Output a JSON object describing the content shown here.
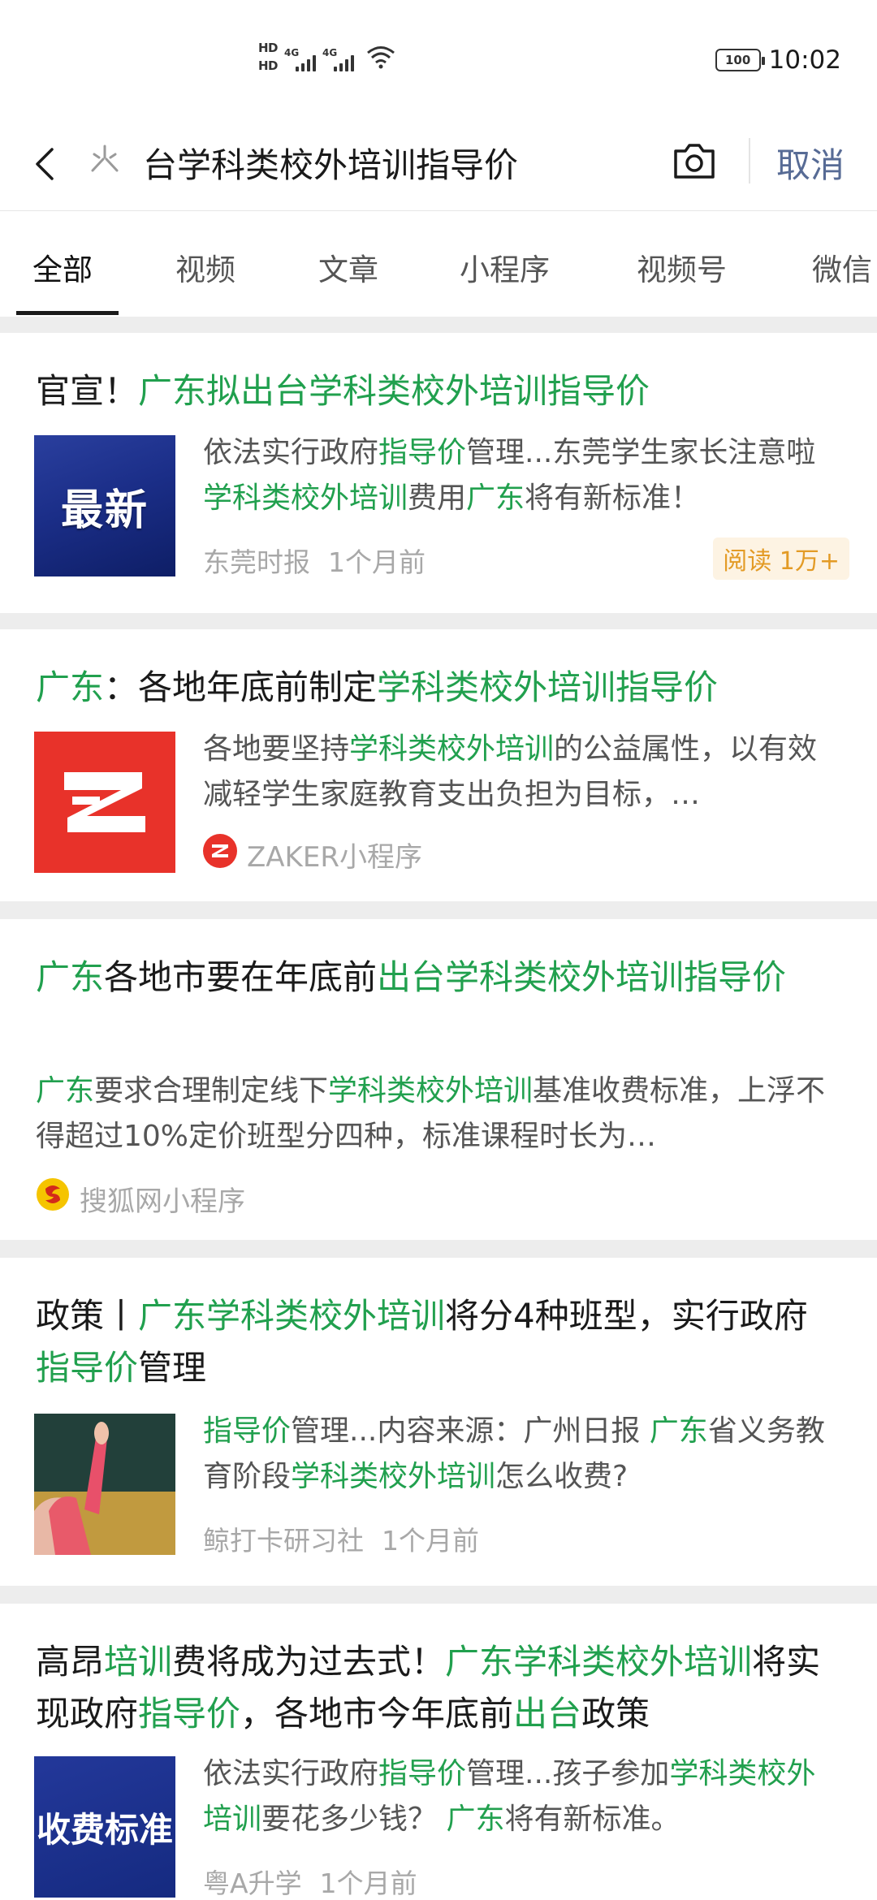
{
  "status_bar": {
    "hd1": "HD",
    "hd2": "HD",
    "net1": "4G",
    "net2": "4G",
    "battery": "100",
    "time": "10:02"
  },
  "search": {
    "query": "台学科类校外培训指导价",
    "cancel_label": "取消"
  },
  "tabs": [
    {
      "label": "全部",
      "active": true
    },
    {
      "label": "视频",
      "active": false
    },
    {
      "label": "文章",
      "active": false
    },
    {
      "label": "小程序",
      "active": false
    },
    {
      "label": "视频号",
      "active": false
    },
    {
      "label": "微信",
      "active": false
    }
  ],
  "colors": {
    "highlight": "#21a04e",
    "cancel": "#576b95",
    "badge": "#e39b26",
    "separator": "#ededed"
  },
  "results": [
    {
      "title_parts": [
        [
          "官宣！",
          false
        ],
        [
          "广东拟出台学科类校外培训指导价",
          true
        ]
      ],
      "thumb_text": "最新",
      "snippet_parts": [
        [
          "依法实行政府",
          false
        ],
        [
          "指导价",
          true
        ],
        [
          "管理...东莞学生家长注意啦",
          false
        ],
        [
          "学科类校外培训",
          true
        ],
        [
          "费用",
          false
        ],
        [
          "广东",
          true
        ],
        [
          "将有新标准！",
          false
        ]
      ],
      "source": "东莞时报",
      "time": "1个月前",
      "badge": "阅读 1万+"
    },
    {
      "title_parts": [
        [
          "广东",
          true
        ],
        [
          "：各地年底前制定",
          false
        ],
        [
          "学科类校外培训指导价",
          true
        ]
      ],
      "thumb_text": "Z",
      "snippet_parts": [
        [
          "各地要坚持",
          false
        ],
        [
          "学科类校外培训",
          true
        ],
        [
          "的公益属性，以有效减轻学生家庭教育支出负担为目标，…",
          false
        ]
      ],
      "source_icon": "zaker-icon",
      "source": "ZAKER小程序"
    },
    {
      "title_parts": [
        [
          "广东",
          true
        ],
        [
          "各地市要在年底前",
          false
        ],
        [
          "出台学科类校外培训指导价",
          true
        ]
      ],
      "snippet_parts": [
        [
          "广东",
          true
        ],
        [
          "要求合理制定线下",
          false
        ],
        [
          "学科类校外培训",
          true
        ],
        [
          "基准收费标准，上浮不得超过10%定价班型分四种，标准课程时长为…",
          false
        ]
      ],
      "source_icon": "sohu-fox-icon",
      "source": "搜狐网小程序"
    },
    {
      "title_parts": [
        [
          "政策丨",
          false
        ],
        [
          "广东学科类校外培训",
          true
        ],
        [
          "将分4种班型，实行政府",
          false
        ],
        [
          "指导价",
          true
        ],
        [
          "管理",
          false
        ]
      ],
      "snippet_parts": [
        [
          "指导价",
          true
        ],
        [
          "管理...内容来源：广州日报 ",
          false
        ],
        [
          "广东",
          true
        ],
        [
          "省义务教育阶段",
          false
        ],
        [
          "学科类校外培训",
          true
        ],
        [
          "怎么收费?",
          false
        ]
      ],
      "source": "鲸打卡研习社",
      "time": "1个月前"
    },
    {
      "title_parts": [
        [
          "高昂",
          false
        ],
        [
          "培训",
          true
        ],
        [
          "费将成为过去式！",
          false
        ],
        [
          "广东学科类校外培训",
          true
        ],
        [
          "将实现政府",
          false
        ],
        [
          "指导价",
          true
        ],
        [
          "，各地市今年底前",
          false
        ],
        [
          "出台",
          true
        ],
        [
          "政策",
          false
        ]
      ],
      "thumb_text": "收费标准",
      "snippet_parts": [
        [
          "依法实行政府",
          false
        ],
        [
          "指导价",
          true
        ],
        [
          "管理...孩子参加",
          false
        ],
        [
          "学科类校外培训",
          true
        ],
        [
          "要花多少钱？ ",
          false
        ],
        [
          "广东",
          true
        ],
        [
          "将有新标准。",
          false
        ]
      ],
      "source": "粤A升学",
      "time": "1个月前"
    }
  ]
}
